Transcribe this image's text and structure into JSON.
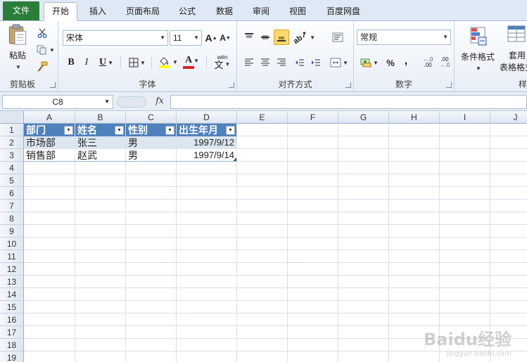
{
  "tabs": [
    "文件",
    "开始",
    "插入",
    "页面布局",
    "公式",
    "数据",
    "审阅",
    "视图",
    "百度网盘"
  ],
  "active_tab": "开始",
  "ribbon": {
    "clipboard": {
      "label": "剪贴板",
      "paste_label": "粘贴"
    },
    "font": {
      "label": "字体",
      "font_name": "宋体",
      "font_size": "11",
      "bold": "B",
      "italic": "I",
      "underline": "U",
      "grow": "A",
      "shrink": "A",
      "wen": "wén",
      "wen_char": "文"
    },
    "alignment": {
      "label": "对齐方式"
    },
    "number": {
      "label": "数字",
      "format": "常规",
      "percent": "%",
      "comma": ",",
      "inc_decimal": ".00",
      "dec_decimal": ".00"
    },
    "styles": {
      "conditional_format": "条件格式",
      "table_format_line1": "套用",
      "table_format_line2": "表格格式",
      "partial_label": "样式"
    }
  },
  "formula_bar": {
    "name_box": "C8",
    "fx": "fx",
    "value": ""
  },
  "columns": [
    "A",
    "B",
    "C",
    "D",
    "E",
    "F",
    "G",
    "H",
    "I",
    "J"
  ],
  "rows": [
    "1",
    "2",
    "3",
    "4",
    "5",
    "6",
    "7",
    "8",
    "9",
    "10",
    "11",
    "12",
    "13",
    "14",
    "15",
    "16",
    "17",
    "18",
    "19"
  ],
  "table": {
    "headers": [
      "部门",
      "姓名",
      "性别",
      "出生年月"
    ],
    "rows": [
      [
        "市场部",
        "张三",
        "男",
        "1997/9/12"
      ],
      [
        "销售部",
        "赵武",
        "男",
        "1997/9/14"
      ]
    ]
  },
  "watermark": {
    "text": "Baidu经验",
    "sub": "jingyan.baidu.com"
  },
  "colors": {
    "accent": "#2a7f38",
    "table_header": "#4f81bd",
    "table_band": "#dce6f1",
    "font_color_red": "#e02020",
    "fill_yellow": "#ffff00"
  }
}
